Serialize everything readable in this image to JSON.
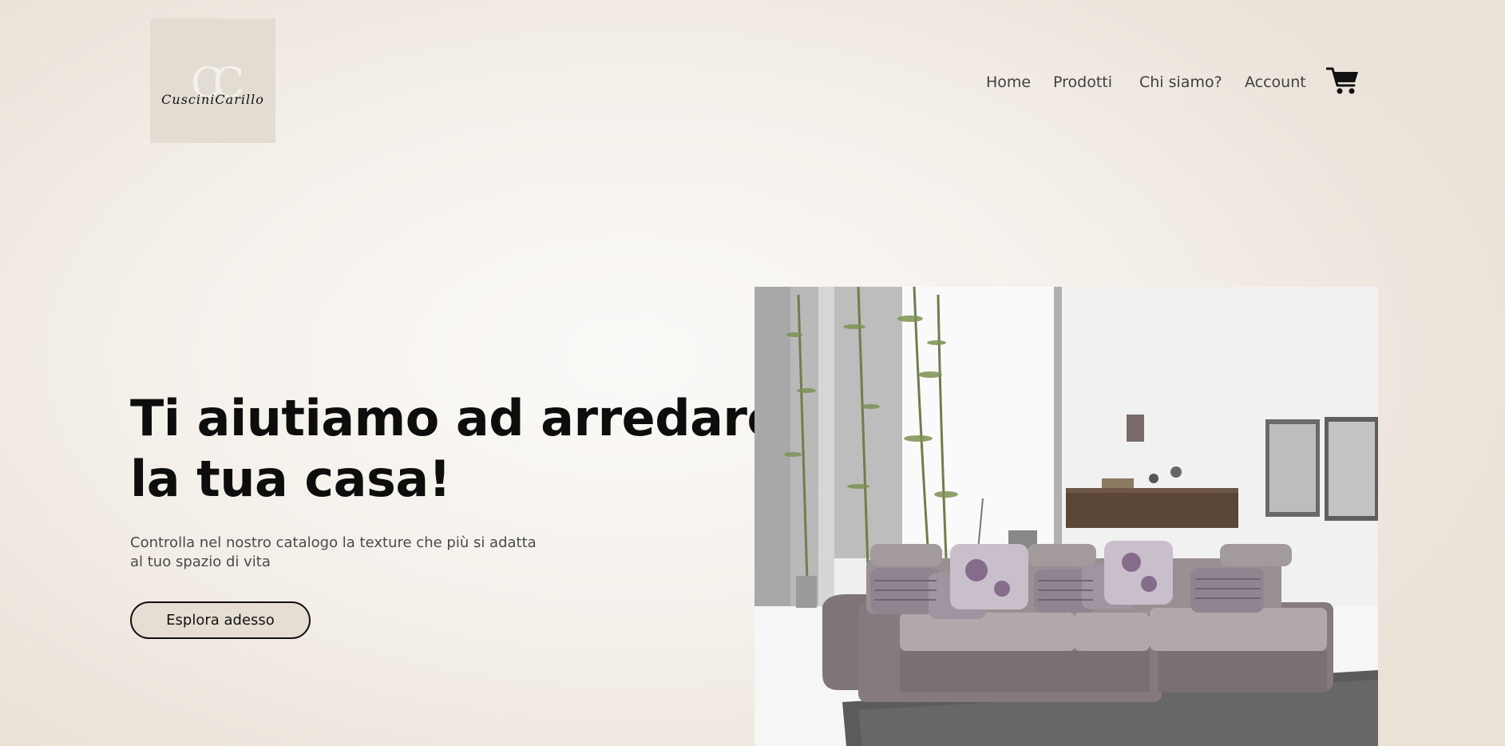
{
  "header": {
    "logo": {
      "monogram": "CC",
      "wordmark": "CusciniCarillo"
    },
    "nav": [
      {
        "label": "Home"
      },
      {
        "label": "Prodotti"
      },
      {
        "label": "Chi siamo?"
      },
      {
        "label": "Account"
      }
    ],
    "cart_icon": "shopping-cart-icon"
  },
  "hero": {
    "title_lines": [
      "Ti aiutiamo ad arredare",
      "la tua casa!"
    ],
    "subtitle_lines": [
      "Controlla nel nostro catalogo la texture che più si adatta",
      "al tuo spazio di vita"
    ],
    "cta_label": "Esplora adesso",
    "image": "living-room-sofa-photo"
  },
  "colors": {
    "background": "#f4efe9",
    "logo_box": "#e3dcd2",
    "button_fill": "#e7ded3",
    "text_dark": "#0d0d0d",
    "text_muted": "#4a4a4a"
  }
}
